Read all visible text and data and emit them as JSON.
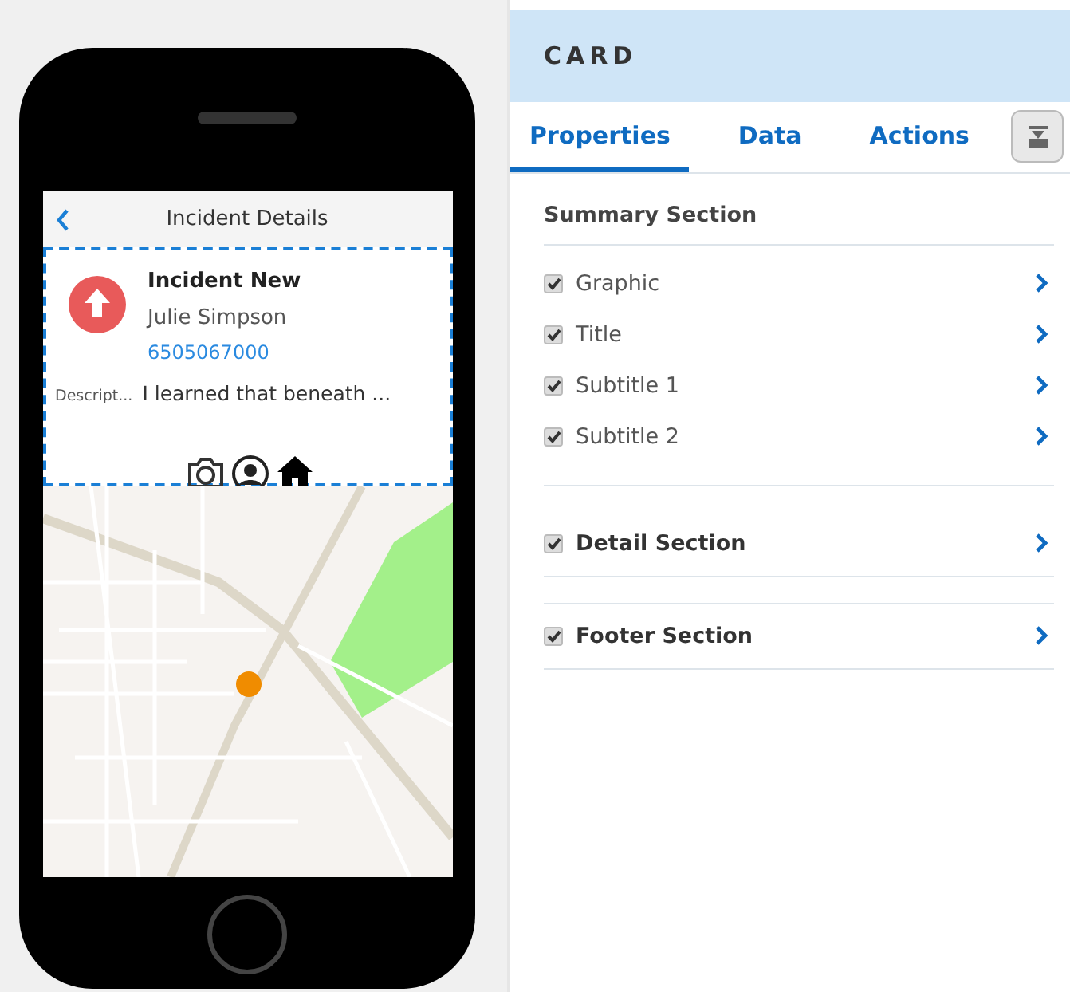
{
  "phone": {
    "header": {
      "title": "Incident Details"
    },
    "card": {
      "title": "Incident New",
      "subtitle_1": "Julie Simpson",
      "subtitle_2": "6505067000",
      "detail_label": "Descript...",
      "detail_value": "I learned that beneath ...",
      "selected": true
    }
  },
  "panel": {
    "title": "CARD",
    "tabs": [
      {
        "label": "Properties",
        "selected": true
      },
      {
        "label": "Data",
        "selected": false
      },
      {
        "label": "Actions",
        "selected": false
      }
    ],
    "summary": {
      "heading": "Summary Section",
      "items": [
        {
          "label": "Graphic",
          "checked": true
        },
        {
          "label": "Title",
          "checked": true
        },
        {
          "label": "Subtitle 1",
          "checked": true
        },
        {
          "label": "Subtitle 2",
          "checked": true
        }
      ]
    },
    "sections": [
      {
        "label": "Detail Section",
        "checked": true
      },
      {
        "label": "Footer Section",
        "checked": true
      }
    ]
  }
}
